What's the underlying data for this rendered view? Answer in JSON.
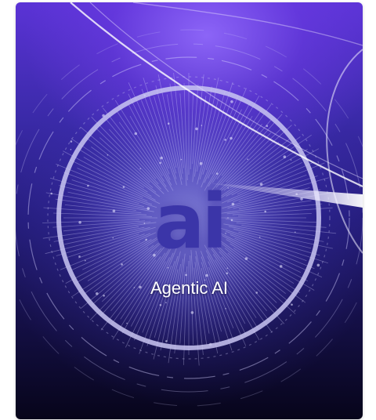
{
  "card": {
    "logo_text": "ai",
    "title": "Agentic AI"
  },
  "colors": {
    "background_top": "#5b33d6",
    "background_bottom": "#07051a",
    "ring": "#c9c6f2",
    "logo": "#3b35a8",
    "title": "#ffffff"
  }
}
